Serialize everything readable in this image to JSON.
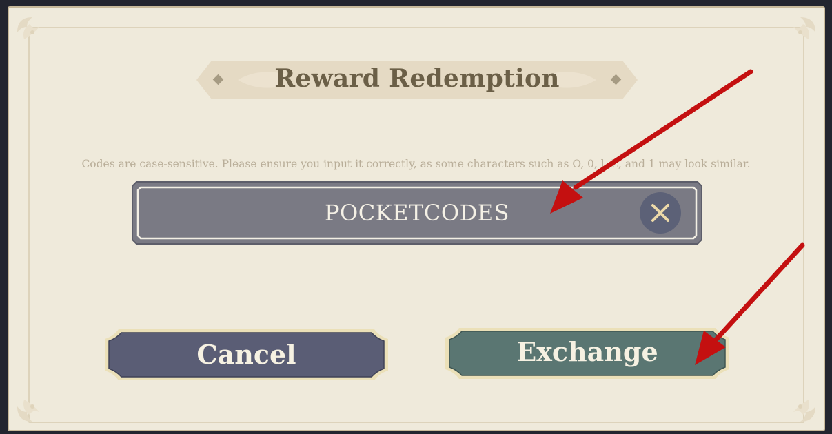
{
  "dialog": {
    "title": "Reward Redemption",
    "hint": "Codes are case-sensitive. Please ensure you input it correctly, as some characters such as O, 0, l, L, and 1 may look similar.",
    "code_input": {
      "value": "POCKETCODES",
      "placeholder": ""
    },
    "buttons": {
      "cancel_label": "Cancel",
      "exchange_label": "Exchange"
    }
  },
  "colors": {
    "panel_background": "#efeadb",
    "title_text": "#6b5f47",
    "input_background": "#7a7a84",
    "cancel_button": "#5a5d75",
    "exchange_button": "#5a7672",
    "annotation_arrow": "#c41010"
  },
  "icons": {
    "clear": "close-x-icon",
    "corner_ornament": "fleur-ornament-icon",
    "annotation": "red-arrow"
  }
}
